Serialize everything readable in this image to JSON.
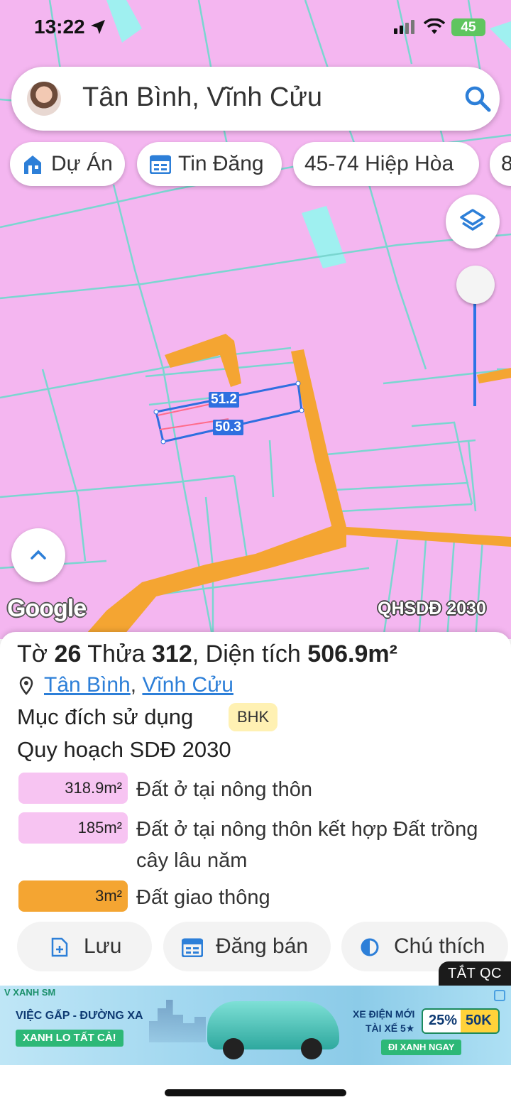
{
  "status_bar": {
    "time": "13:22",
    "battery": "45"
  },
  "search": {
    "title": "Tân Bình, Vĩnh Cửu"
  },
  "chips": [
    {
      "label": "Dự Án",
      "icon": "building-icon"
    },
    {
      "label": "Tin Đăng",
      "icon": "listing-icon"
    },
    {
      "label": "45-74 Hiệp Hòa",
      "icon": ""
    },
    {
      "label": "8",
      "icon": ""
    }
  ],
  "map": {
    "measure_top": "51.2",
    "measure_bottom": "50.3",
    "google_logo": "Google",
    "layer_name": "QHSDĐ 2030",
    "colors": {
      "residential": "#f4b6f0",
      "road": "#f4a532",
      "water": "#9ff0f0",
      "border": "#7ad6d0",
      "selection": "#2f6fe0"
    }
  },
  "parcel": {
    "title_prefix": "Tờ",
    "sheet_no": "26",
    "title_mid": "Thửa",
    "parcel_no": "312",
    "area_label": ", Diện tích",
    "area": "506.9m²",
    "ward": "Tân Bình",
    "separator": ",",
    "district": "Vĩnh Cửu",
    "purpose_label": "Mục đích sử dụng",
    "purpose_code": "BHK",
    "plan_label": "Quy hoạch SDĐ 2030",
    "zones": [
      {
        "area": "318.9m²",
        "label": "Đất ở tại nông thôn",
        "color": "#f7c4f2"
      },
      {
        "area": "185m²",
        "label": "Đất ở tại nông thôn kết hợp Đất trồng cây lâu năm",
        "color": "#f7c4f2"
      },
      {
        "area": "3m²",
        "label": "Đất giao thông",
        "color": "#f4a532"
      }
    ]
  },
  "actions": {
    "save": "Lưu",
    "post_sale": "Đăng bán",
    "legend": "Chú thích"
  },
  "ad": {
    "close_label": "TẮT QC",
    "brand": "V XANH SM",
    "line1": "VIỆC GẤP - ĐƯỜNG XA",
    "line2": "XANH LO TẤT CẢ!",
    "right1": "XE ĐIỆN MỚI",
    "right2": "TÀI XẾ 5★",
    "cta": "ĐI XANH NGAY",
    "discount": "25%",
    "amount": "50K"
  }
}
